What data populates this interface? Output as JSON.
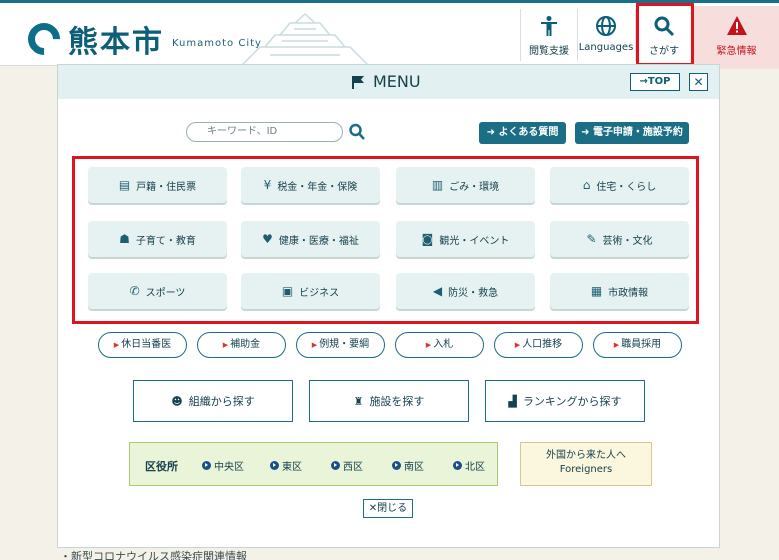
{
  "header": {
    "logo_text": "熊本市",
    "logo_en": "Kumamoto City",
    "support_label": "閲覧支援",
    "languages_label": "Languages",
    "search_label": "さがす",
    "emergency_label": "緊急情報"
  },
  "menu": {
    "title": "MENU",
    "top_button": "TOP",
    "close_x": "✕",
    "search_placeholder": "キーワード、ID",
    "faq_button": "よくある質問",
    "online_button": "電子申請・施設予約",
    "categories": [
      {
        "label": "戸籍・住民票",
        "icon": "document-icon"
      },
      {
        "label": "税金・年金・保険",
        "icon": "yen-icon"
      },
      {
        "label": "ごみ・環境",
        "icon": "trash-icon"
      },
      {
        "label": "住宅・くらし",
        "icon": "house-icon"
      },
      {
        "label": "子育て・教育",
        "icon": "stroller-icon"
      },
      {
        "label": "健康・医療・福祉",
        "icon": "care-icon"
      },
      {
        "label": "観光・イベント",
        "icon": "camera-icon"
      },
      {
        "label": "芸術・文化",
        "icon": "brush-icon"
      },
      {
        "label": "スポーツ",
        "icon": "whistle-icon"
      },
      {
        "label": "ビジネス",
        "icon": "briefcase-icon"
      },
      {
        "label": "防災・救急",
        "icon": "megaphone-icon"
      },
      {
        "label": "市政情報",
        "icon": "building-icon"
      }
    ],
    "quick_links": [
      "休日当番医",
      "補助金",
      "例規・要綱",
      "入札",
      "人口推移",
      "職員採用"
    ],
    "browse": [
      "組織から探す",
      "施設を探す",
      "ランキングから探す"
    ],
    "ward_label": "区役所",
    "wards": [
      "中央区",
      "東区",
      "西区",
      "南区",
      "北区"
    ],
    "foreign_line1": "外国から来た人へ",
    "foreign_line2": "Foreigners",
    "close_button": "✕閉じる"
  },
  "colors": {
    "primary": "#1b6e85",
    "highlight": "#e0141e",
    "emergency_bg": "#f7dedc",
    "category_bg": "#e6f2f1"
  },
  "below_text": "・新型コロナウイルス感染症関連情報"
}
